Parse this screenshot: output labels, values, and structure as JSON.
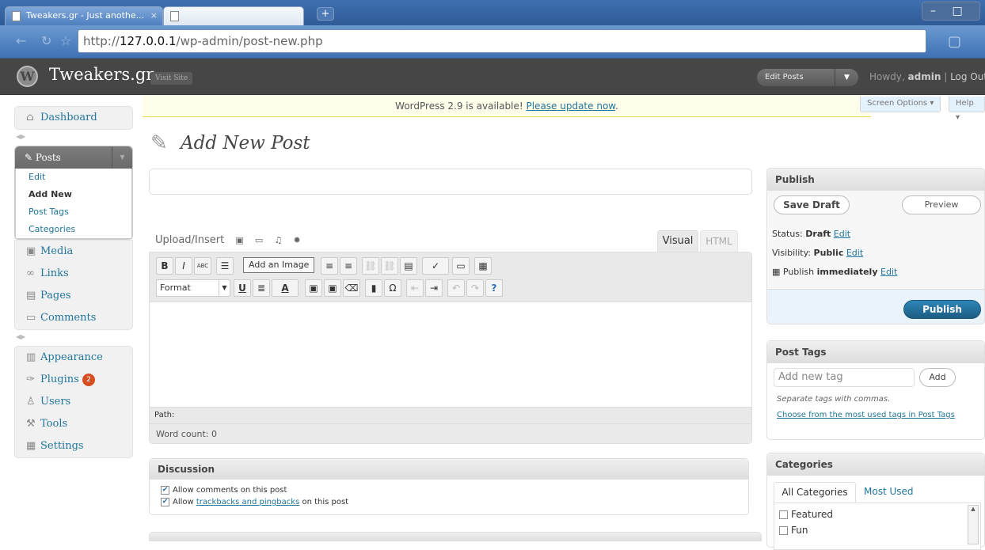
{
  "browser": {
    "tab1_title": "Tweakers.gr - Just anothe...",
    "tab1_close": "×",
    "tab2_title": "",
    "new_tab": "+",
    "url_prefix": "http://",
    "url_host": "127.0.0.1",
    "url_path": "/wp-admin/post-new.php",
    "window_controls": "–  □"
  },
  "header": {
    "logo": "W",
    "site_title": "Tweakers.gr",
    "visit_site": "Visit Site",
    "favorite_action": "Edit Posts",
    "howdy_prefix": "Howdy, ",
    "username": "admin",
    "separator": " | ",
    "logout": "Log Out"
  },
  "notice": {
    "text": "WordPress 2.9 is available! ",
    "link": "Please update now",
    "suffix": "."
  },
  "screen_options": "Screen Options",
  "help": "Help",
  "menu": {
    "dashboard": "Dashboard",
    "posts": "Posts",
    "posts_sub": [
      "Edit",
      "Add New",
      "Post Tags",
      "Categories"
    ],
    "media": "Media",
    "links": "Links",
    "pages": "Pages",
    "comments": "Comments",
    "appearance": "Appearance",
    "plugins": "Plugins",
    "plugins_count": "2",
    "users": "Users",
    "tools": "Tools",
    "settings": "Settings"
  },
  "page_title": "Add New Post",
  "editor": {
    "upload_insert": "Upload/Insert",
    "tab_visual": "Visual",
    "tab_html": "HTML",
    "tooltip": "Add an Image",
    "format_select": "Format",
    "path_label": "Path:",
    "word_count": "Word count: 0",
    "toolbar_row1": [
      "B",
      "I",
      "ABC",
      "☰",
      "≡",
      "≡",
      "≡",
      "≡",
      "⛓",
      "⛓",
      "▤",
      "✓",
      "▭",
      "▦"
    ],
    "toolbar_row2": [
      "U",
      "≣",
      "A",
      "▣",
      "▣",
      "⌫",
      "▮",
      "Ω",
      "⇤",
      "⇥",
      "↶",
      "↷",
      "?"
    ]
  },
  "discussion": {
    "title": "Discussion",
    "allow_comments": "Allow comments on this post",
    "allow_prefix": "Allow ",
    "trackbacks_link": "trackbacks and pingbacks",
    "allow_suffix": " on this post"
  },
  "publish": {
    "title": "Publish",
    "save_draft": "Save Draft",
    "preview": "Preview",
    "status_label": "Status: ",
    "status_value": "Draft",
    "visibility_label": "Visibility: ",
    "visibility_value": "Public",
    "publish_label": "Publish ",
    "publish_when": "immediately",
    "edit_link": "Edit",
    "publish_button": "Publish"
  },
  "post_tags": {
    "title": "Post Tags",
    "placeholder": "Add new tag",
    "add_button": "Add",
    "note": "Separate tags with commas.",
    "choose_link": "Choose from the most used tags in Post Tags"
  },
  "categories": {
    "title": "Categories",
    "tab_all": "All Categories",
    "tab_most_used": "Most Used",
    "items": [
      "Featured",
      "Fun"
    ]
  }
}
